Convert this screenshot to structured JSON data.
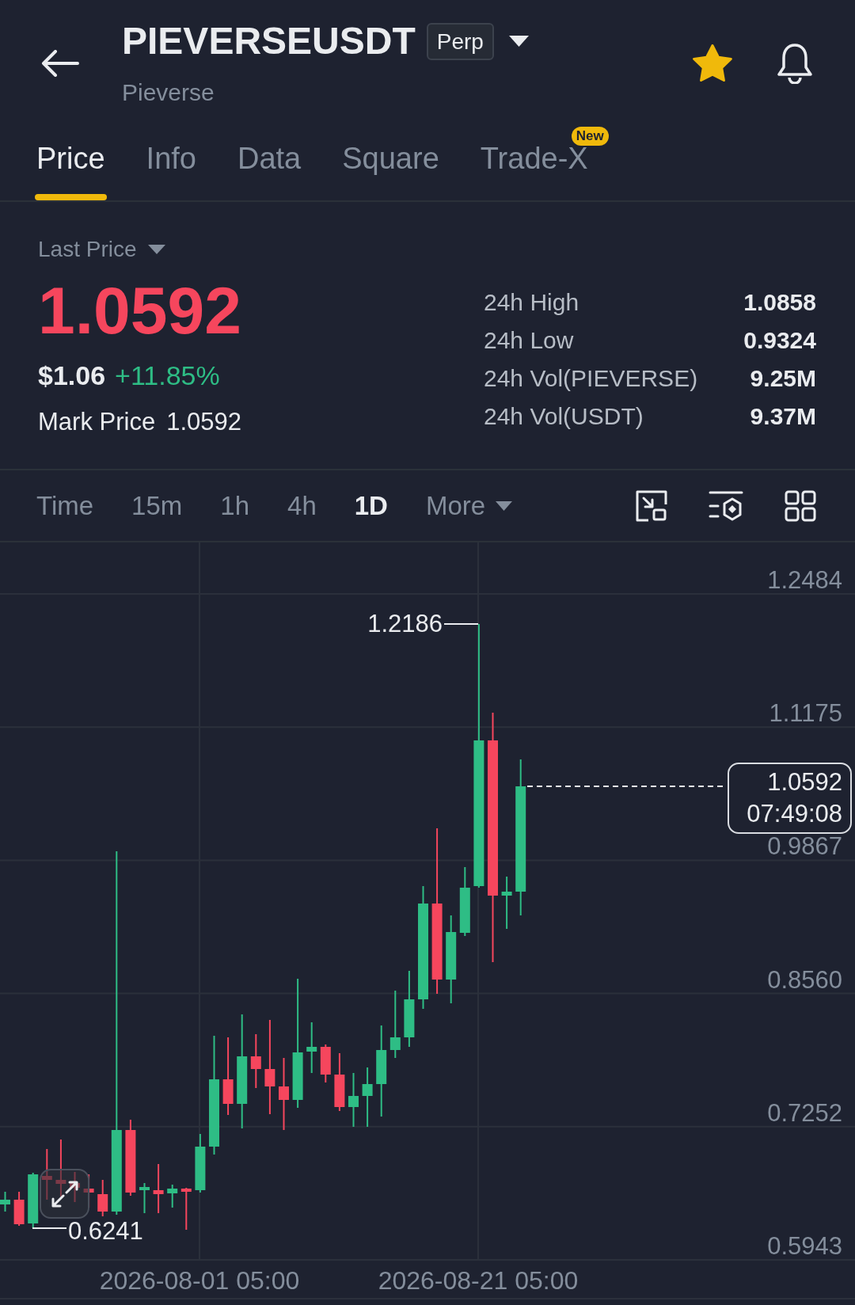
{
  "header": {
    "symbol": "PIEVERSEUSDT",
    "contract_badge": "Perp",
    "name": "Pieverse",
    "favorite": true
  },
  "tabs": [
    {
      "label": "Price",
      "selected": true
    },
    {
      "label": "Info",
      "selected": false
    },
    {
      "label": "Data",
      "selected": false
    },
    {
      "label": "Square",
      "selected": false
    },
    {
      "label": "Trade-X",
      "selected": false,
      "badge": "New"
    }
  ],
  "price_panel": {
    "price_type": "Last Price",
    "last_price": "1.0592",
    "last_price_up": false,
    "usd_price": "$1.06",
    "change": "+11.85%",
    "change_up": true,
    "mark_price_label": "Mark Price",
    "mark_price": "1.0592",
    "stats": [
      {
        "label": "24h High",
        "value": "1.0858"
      },
      {
        "label": "24h Low",
        "value": "0.9324"
      },
      {
        "label": "24h Vol(PIEVERSE)",
        "value": "9.25M"
      },
      {
        "label": "24h Vol(USDT)",
        "value": "9.37M"
      }
    ]
  },
  "intervals": [
    {
      "label": "Time",
      "kind": "option",
      "selected": false
    },
    {
      "label": "15m",
      "kind": "option",
      "selected": false
    },
    {
      "label": "1h",
      "kind": "option",
      "selected": false
    },
    {
      "label": "4h",
      "kind": "option",
      "selected": false
    },
    {
      "label": "1D",
      "kind": "option",
      "selected": true
    },
    {
      "label": "More",
      "kind": "dropdown",
      "selected": false
    }
  ],
  "chart": {
    "y_axis_labels": [
      "1.2484",
      "1.1175",
      "0.9867",
      "0.8560",
      "0.7252",
      "0.5943"
    ],
    "x_axis_labels": [
      "2026-08-01 05:00",
      "2026-08-21 05:00"
    ],
    "high_label": "1.2186",
    "low_label": "0.6241",
    "last_price_tag": "1.0592",
    "countdown": "07:49:08"
  }
}
